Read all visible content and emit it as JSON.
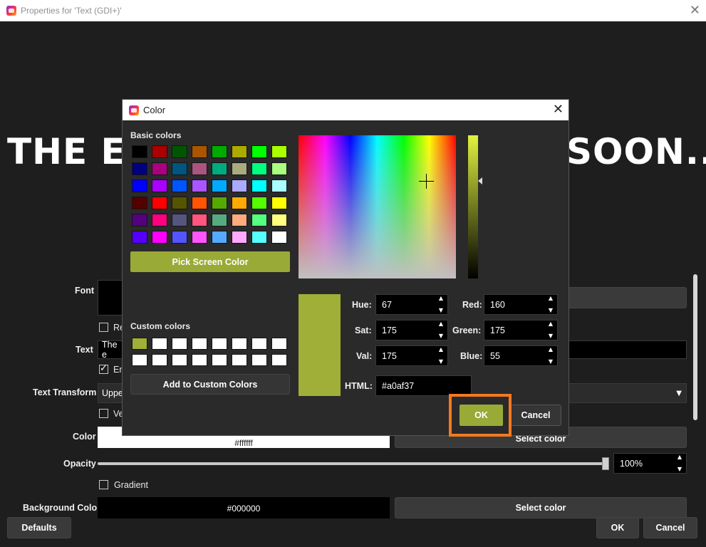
{
  "window": {
    "title": "Properties for 'Text (GDI+)'"
  },
  "preview": {
    "left_text": "THE EV",
    "right_text": "SOON..."
  },
  "properties": {
    "font_label": "Font",
    "checkbox_read_label": "Re",
    "text_label": "Text",
    "text_value": "The e",
    "checkbox_enable_label": "En",
    "text_transform_label": "Text Transform",
    "text_transform_value": "Uppe",
    "checkbox_vertical_label": "Ve",
    "color_label": "Color",
    "color_value": "#ffffff",
    "color_button": "Select color",
    "opacity_label": "Opacity",
    "opacity_value": "100%",
    "gradient_label": "Gradient",
    "bg_color_label": "Background Color",
    "bg_color_value": "#000000",
    "bg_color_button": "Select color"
  },
  "footer": {
    "defaults": "Defaults",
    "ok": "OK",
    "cancel": "Cancel"
  },
  "color_dialog": {
    "title": "Color",
    "basic_colors_label": "Basic colors",
    "basic_colors": [
      "#000000",
      "#aa0000",
      "#005500",
      "#aa5500",
      "#00aa00",
      "#aaaa00",
      "#00ff00",
      "#aaff00",
      "#00007f",
      "#aa007f",
      "#00557f",
      "#aa557f",
      "#00aa7f",
      "#aaaa7f",
      "#00ff7f",
      "#aaff7f",
      "#0000ff",
      "#aa00ff",
      "#0055ff",
      "#aa55ff",
      "#00aaff",
      "#aaaaff",
      "#00ffff",
      "#aaffff",
      "#550000",
      "#ff0000",
      "#555500",
      "#ff5500",
      "#55aa00",
      "#ffaa00",
      "#55ff00",
      "#ffff00",
      "#55007f",
      "#ff007f",
      "#55557f",
      "#ff557f",
      "#55aa7f",
      "#ffaa7f",
      "#55ff7f",
      "#ffff7f",
      "#5500ff",
      "#ff00ff",
      "#5555ff",
      "#ff55ff",
      "#55aaff",
      "#ffaaff",
      "#55ffff",
      "#ffffff"
    ],
    "pick_screen_color": "Pick Screen Color",
    "custom_colors_label": "Custom colors",
    "custom_colors": [
      "#a0af37",
      "#ffffff",
      "#ffffff",
      "#ffffff",
      "#ffffff",
      "#ffffff",
      "#ffffff",
      "#ffffff",
      "#ffffff",
      "#ffffff",
      "#ffffff",
      "#ffffff",
      "#ffffff",
      "#ffffff",
      "#ffffff",
      "#ffffff"
    ],
    "add_custom": "Add to Custom Colors",
    "hue_label": "Hue:",
    "hue": "67",
    "sat_label": "Sat:",
    "sat": "175",
    "val_label": "Val:",
    "val": "175",
    "red_label": "Red:",
    "red": "160",
    "green_label": "Green:",
    "green": "175",
    "blue_label": "Blue:",
    "blue": "55",
    "html_label": "HTML:",
    "html": "#a0af37",
    "current_color": "#a0af37",
    "ok": "OK",
    "cancel": "Cancel"
  },
  "icons": {
    "close": "close-icon",
    "app": "app-logo-icon"
  }
}
